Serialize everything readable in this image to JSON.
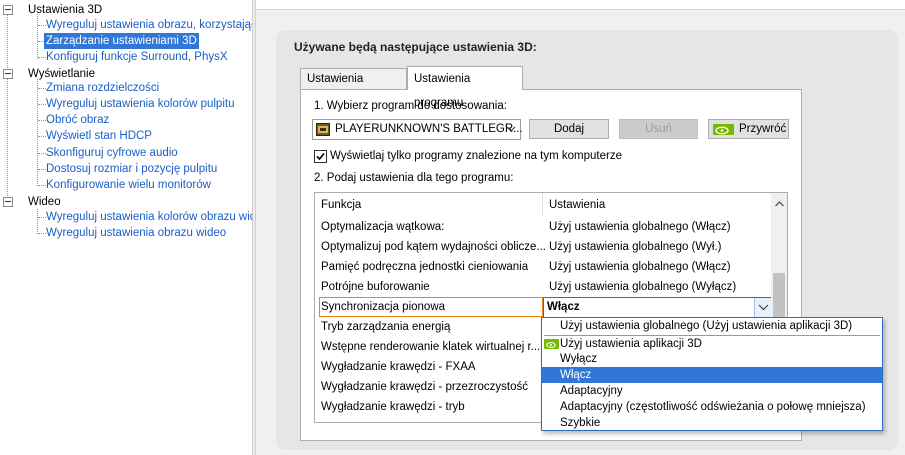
{
  "tree": {
    "categories": [
      {
        "label": "Ustawienia 3D",
        "items": [
          "Wyreguluj ustawienia obrazu, korzystając z podglądu",
          "Zarządzanie ustawieniami 3D",
          "Konfiguruj funkcje Surround, PhysX"
        ]
      },
      {
        "label": "Wyświetlanie",
        "items": [
          "Zmiana rozdzielczości",
          "Wyreguluj ustawienia kolorów pulpitu",
          "Obróć obraz",
          "Wyświetl stan HDCP",
          "Skonfiguruj cyfrowe audio",
          "Dostosuj rozmiar i pozycję pulpitu",
          "Konfigurowanie wielu monitorów"
        ]
      },
      {
        "label": "Wideo",
        "items": [
          "Wyreguluj ustawienia kolorów obrazu wideo",
          "Wyreguluj ustawienia obrazu wideo"
        ]
      }
    ],
    "selected": "Zarządzanie ustawieniami 3D"
  },
  "panel": {
    "title": "Używane będą następujące ustawienia 3D:",
    "tabs": [
      "Ustawienia globalne",
      "Ustawienia programu"
    ],
    "active_tab": "Ustawienia programu",
    "step1_label": "1. Wybierz program do dostosowania:",
    "program_select": "PLAYERUNKNOWN'S BATTLEGR...",
    "add_button": "Dodaj",
    "remove_button": "Usuń",
    "restore_button": "Przywróć",
    "show_only_checkbox": "Wyświetlaj tylko programy znalezione na tym komputerze",
    "show_only_checked": true,
    "step2_label": "2. Podaj ustawienia dla tego programu:"
  },
  "settings_table": {
    "columns": [
      "Funkcja",
      "Ustawienia"
    ],
    "rows": [
      {
        "feature": "Optymalizacja wątkowa:",
        "value": "Użyj ustawienia globalnego (Włącz)"
      },
      {
        "feature": "Optymalizuj pod kątem wydajności oblicze...",
        "value": "Użyj ustawienia globalnego (Wył.)"
      },
      {
        "feature": "Pamięć podręczna jednostki cieniowania",
        "value": "Użyj ustawienia globalnego (Włącz)"
      },
      {
        "feature": "Potrójne buforowanie",
        "value": "Użyj ustawienia globalnego (Wyłącz)"
      },
      {
        "feature": "Synchronizacja pionowa",
        "value": "Włącz"
      },
      {
        "feature": "Tryb zarządzania energią",
        "value": ""
      },
      {
        "feature": "Wstępne renderowanie klatek wirtualnej r...",
        "value": ""
      },
      {
        "feature": "Wygładzanie krawędzi - FXAA",
        "value": ""
      },
      {
        "feature": "Wygładzanie krawędzi - przezroczystość",
        "value": ""
      },
      {
        "feature": "Wygładzanie krawędzi - tryb",
        "value": ""
      }
    ],
    "selected_row": "Synchronizacja pionowa"
  },
  "dropdown": {
    "options": [
      "Użyj ustawienia globalnego (Użyj ustawienia aplikacji 3D)",
      "Użyj ustawienia aplikacji 3D",
      "Wyłącz",
      "Włącz",
      "Adaptacyjny",
      "Adaptacyjny (częstotliwość odświeżania o połowę mniejsza)",
      "Szybkie"
    ],
    "highlighted": "Włącz",
    "icon_option": "Użyj ustawienia aplikacji 3D"
  },
  "colors": {
    "selection_blue": "#3177d8",
    "link_blue": "#1a5ec9",
    "nvidia_green": "#76b900"
  }
}
